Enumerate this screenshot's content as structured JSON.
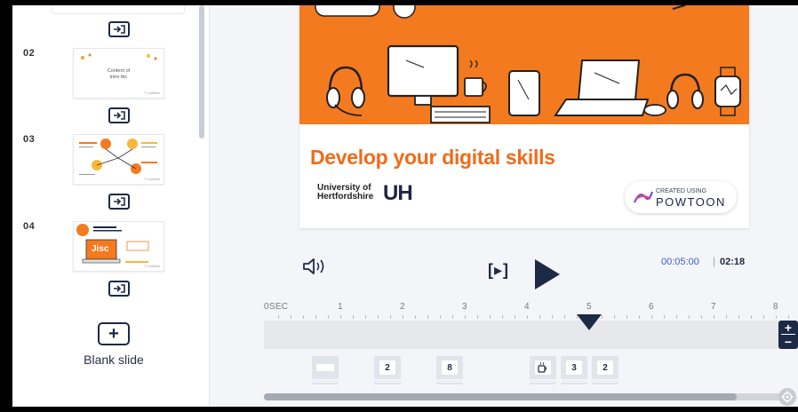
{
  "sidebar": {
    "slides": [
      {
        "number": "02",
        "caption": "Content of\nintro tbc",
        "mark": "© UofHerts"
      },
      {
        "number": "03",
        "caption": "",
        "mark": "© UofHerts"
      },
      {
        "number": "04",
        "caption": "Jisc",
        "mark": "© UofHerts"
      }
    ],
    "blank_slide_label": "Blank slide",
    "blank_slide_icon": "plus-square-icon",
    "transition_icon": "transition-enter-icon"
  },
  "slide": {
    "title": "Develop your digital skills",
    "university_line1": "University of",
    "university_line2": "Hertfordshire",
    "university_mark": "UH",
    "powtoon_small": "CREATED USING",
    "powtoon_big": "POWTOON",
    "colors": {
      "hero": "#f47a1f",
      "title": "#f06b1b",
      "navy": "#1d2a45"
    }
  },
  "controls": {
    "volume_icon": "speaker-icon",
    "preview_label": "[▸]",
    "play_icon": "play-icon",
    "current_time": "00:05:00",
    "separator": "|",
    "total_time": "02:18"
  },
  "timeline": {
    "ruler_labels": [
      "0SEC",
      "1",
      "2",
      "3",
      "4",
      "5",
      "6",
      "7",
      "8"
    ],
    "playhead_seconds": 5,
    "zoom_in": "+",
    "zoom_out": "−",
    "objects": [
      {
        "label": "",
        "icon": "text-box-icon"
      },
      {
        "label": "2",
        "icon": ""
      },
      {
        "label": "8",
        "icon": ""
      },
      {
        "label": "",
        "icon": "coffee-cup-icon"
      },
      {
        "label": "3",
        "icon": ""
      },
      {
        "label": "2",
        "icon": ""
      }
    ]
  }
}
